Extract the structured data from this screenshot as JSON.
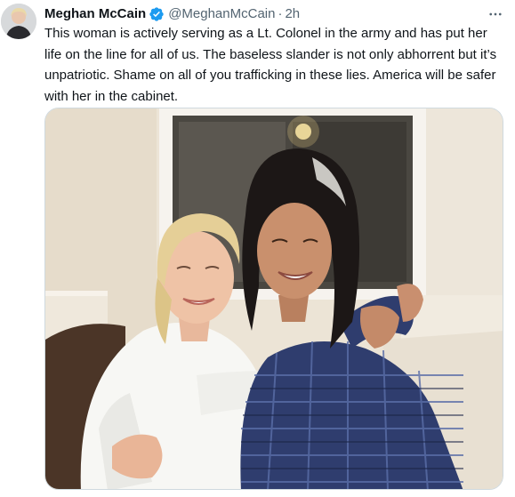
{
  "author": {
    "display_name": "Meghan McCain",
    "handle": "@MeghanMcCain",
    "separator": "·",
    "time": "2h",
    "verified": true,
    "verified_icon": "verified-badge-icon",
    "avatar_icon": "profile-avatar"
  },
  "tweet": {
    "text": "This woman is actively serving as a Lt. Colonel in the army and has put her life on the line for all of us. The baseless slander is not only abhorrent but it’s unpatriotic. Shame on all of you trafficking in these lies. America will be safer with her in the cabinet."
  },
  "media": {
    "icon": "photo-two-women-hugging"
  },
  "menu": {
    "icon": "more-options-icon"
  },
  "colors": {
    "text": "#0f1419",
    "secondary": "#536471",
    "verified_blue": "#1d9bf0",
    "border": "#cfd9de"
  }
}
